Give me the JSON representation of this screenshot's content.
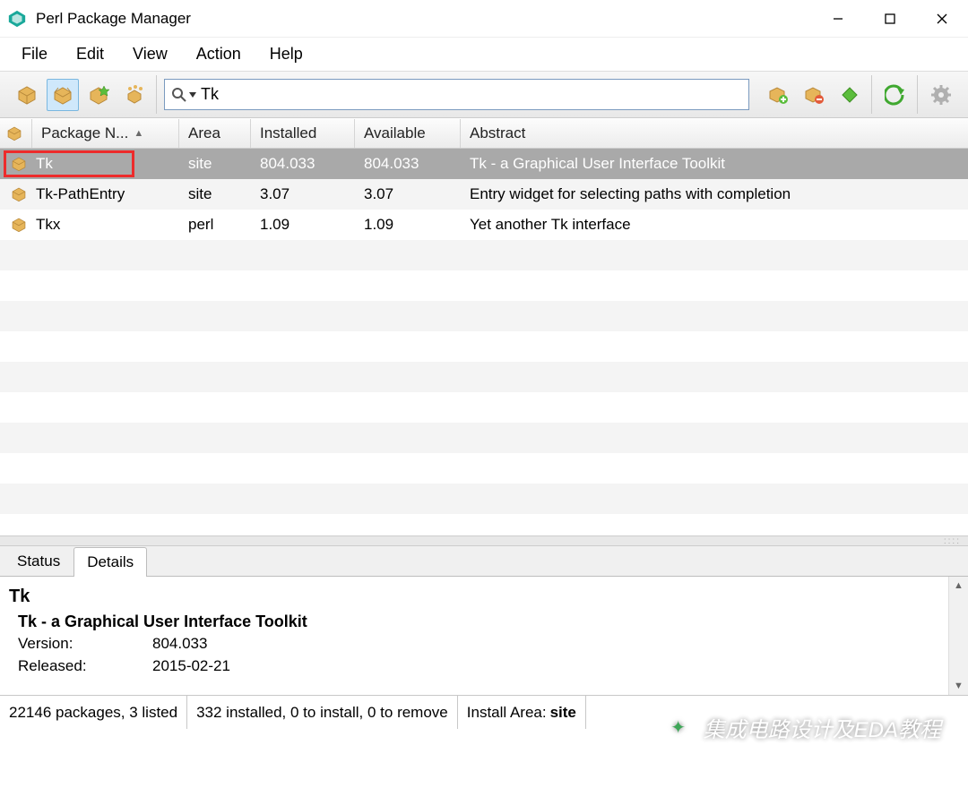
{
  "window": {
    "title": "Perl Package Manager"
  },
  "menu": {
    "items": [
      "File",
      "Edit",
      "View",
      "Action",
      "Help"
    ]
  },
  "search": {
    "value": "Tk"
  },
  "table": {
    "columns": [
      "Package N...",
      "Area",
      "Installed",
      "Available",
      "Abstract"
    ],
    "rows": [
      {
        "name": "Tk",
        "area": "site",
        "installed": "804.033",
        "available": "804.033",
        "abstract": "Tk - a Graphical User Interface Toolkit",
        "selected": true
      },
      {
        "name": "Tk-PathEntry",
        "area": "site",
        "installed": "3.07",
        "available": "3.07",
        "abstract": "Entry widget for selecting paths with completion",
        "selected": false
      },
      {
        "name": "Tkx",
        "area": "perl",
        "installed": "1.09",
        "available": "1.09",
        "abstract": "Yet another Tk interface",
        "selected": false
      }
    ]
  },
  "tabs": {
    "items": [
      "Status",
      "Details"
    ],
    "active": 1
  },
  "details": {
    "title": "Tk",
    "subtitle": "Tk - a Graphical User Interface Toolkit",
    "version_label": "Version:",
    "version": "804.033",
    "released_label": "Released:",
    "released": "2015-02-21"
  },
  "status": {
    "packages": "22146 packages, 3 listed",
    "installed": "332 installed, 0 to install, 0 to remove",
    "area_label": "Install Area:",
    "area_value": "site"
  },
  "watermark": "集成电路设计及EDA教程"
}
